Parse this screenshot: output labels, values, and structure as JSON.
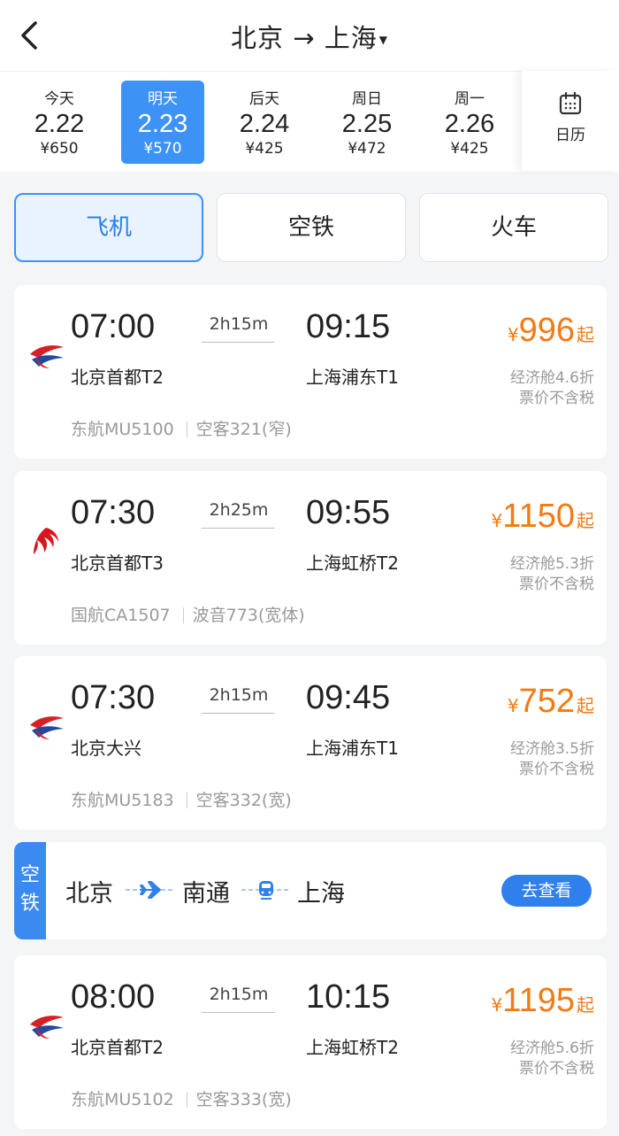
{
  "header": {
    "title": "北京 → 上海"
  },
  "date_bar": {
    "dates": [
      {
        "label": "今天",
        "date": "2.22",
        "price": "¥650",
        "selected": false
      },
      {
        "label": "明天",
        "date": "2.23",
        "price": "¥570",
        "selected": true
      },
      {
        "label": "后天",
        "date": "2.24",
        "price": "¥425",
        "selected": false
      },
      {
        "label": "周日",
        "date": "2.25",
        "price": "¥472",
        "selected": false
      },
      {
        "label": "周一",
        "date": "2.26",
        "price": "¥425",
        "selected": false
      }
    ],
    "calendar_label": "日历"
  },
  "modes": [
    {
      "label": "飞机",
      "active": true
    },
    {
      "label": "空铁",
      "active": false
    },
    {
      "label": "火车",
      "active": false
    }
  ],
  "flights": [
    {
      "dep_time": "07:00",
      "arr_time": "09:15",
      "duration": "2h15m",
      "dep_airport": "北京首都T2",
      "arr_airport": "上海浦东T1",
      "currency": "¥",
      "price": "996",
      "price_suffix": "起",
      "cabin": "经济舱4.6折",
      "tax_note": "票价不含税",
      "airline": "东航MU5100",
      "aircraft": "空客321(窄)",
      "logo": "china-eastern-logo"
    },
    {
      "dep_time": "07:30",
      "arr_time": "09:55",
      "duration": "2h25m",
      "dep_airport": "北京首都T3",
      "arr_airport": "上海虹桥T2",
      "currency": "¥",
      "price": "1150",
      "price_suffix": "起",
      "cabin": "经济舱5.3折",
      "tax_note": "票价不含税",
      "airline": "国航CA1507",
      "aircraft": "波音773(宽体)",
      "logo": "air-china-logo"
    },
    {
      "dep_time": "07:30",
      "arr_time": "09:45",
      "duration": "2h15m",
      "dep_airport": "北京大兴",
      "arr_airport": "上海浦东T1",
      "currency": "¥",
      "price": "752",
      "price_suffix": "起",
      "cabin": "经济舱3.5折",
      "tax_note": "票价不含税",
      "airline": "东航MU5183",
      "aircraft": "空客332(宽)",
      "logo": "china-eastern-logo"
    },
    {
      "dep_time": "08:00",
      "arr_time": "10:15",
      "duration": "2h15m",
      "dep_airport": "北京首都T2",
      "arr_airport": "上海虹桥T2",
      "currency": "¥",
      "price": "1195",
      "price_suffix": "起",
      "cabin": "经济舱5.6折",
      "tax_note": "票价不含税",
      "airline": "东航MU5102",
      "aircraft": "空客333(宽)",
      "logo": "china-eastern-logo"
    }
  ],
  "combo": {
    "tag_line1": "空",
    "tag_line2": "铁",
    "from": "北京",
    "via": "南通",
    "to": "上海",
    "button": "去查看"
  },
  "colors": {
    "accent": "#3d92f5",
    "price": "#f47a12",
    "muted": "#999999",
    "china_eastern_red": "#d71f26",
    "china_eastern_blue": "#1f4aa0",
    "air_china_red": "#d8141f"
  }
}
